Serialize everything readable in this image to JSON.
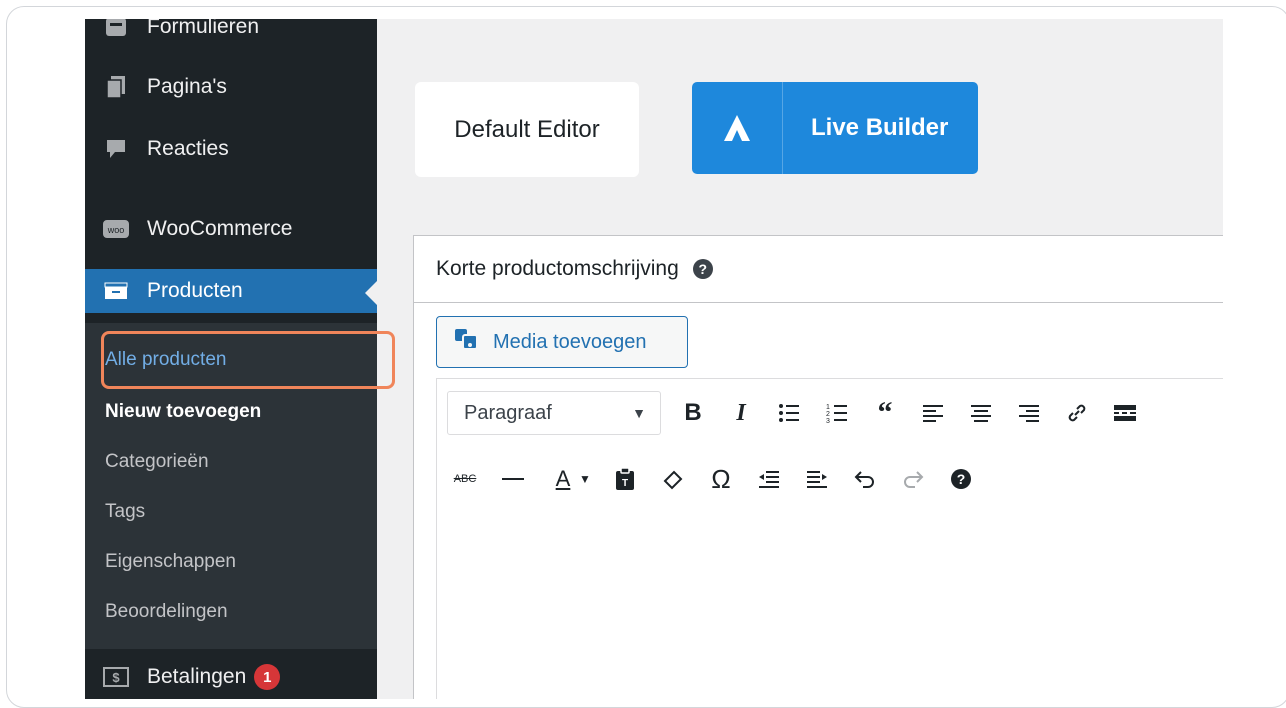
{
  "sidebar": {
    "items": [
      {
        "label": "Formulieren",
        "icon": "form-icon"
      },
      {
        "label": "Pagina's",
        "icon": "pages-icon"
      },
      {
        "label": "Reacties",
        "icon": "comments-icon"
      },
      {
        "label": "WooCommerce",
        "icon": "woo-icon",
        "icon_text": "woo"
      },
      {
        "label": "Producten",
        "icon": "archive-icon"
      },
      {
        "label": "Betalingen",
        "icon": "payments-icon",
        "badge": "1"
      }
    ],
    "submenu": [
      {
        "label": "Alle producten"
      },
      {
        "label": "Nieuw toevoegen"
      },
      {
        "label": "Categorieën"
      },
      {
        "label": "Tags"
      },
      {
        "label": "Eigenschappen"
      },
      {
        "label": "Beoordelingen"
      }
    ]
  },
  "editor_switch": {
    "default_label": "Default Editor",
    "live_label": "Live Builder"
  },
  "metabox": {
    "title": "Korte productomschrijving",
    "help": "?",
    "media_button": "Media toevoegen",
    "format_select": "Paragraaf",
    "toolbar_row1": [
      "bold-icon",
      "italic-icon",
      "bullet-list-icon",
      "numbered-list-icon",
      "blockquote-icon",
      "align-left-icon",
      "align-center-icon",
      "align-right-icon",
      "link-icon",
      "read-more-icon"
    ],
    "toolbar_row2": [
      "strikethrough-icon",
      "horizontal-line-icon",
      "text-color-icon",
      "paste-text-icon",
      "clear-formatting-icon",
      "special-character-icon",
      "outdent-icon",
      "indent-icon",
      "undo-icon",
      "redo-icon",
      "help-icon"
    ]
  },
  "colors": {
    "sidebar_bg": "#1d2327",
    "active_bg": "#2271b1",
    "live_builder": "#1e88dc",
    "highlight": "#f0855a"
  }
}
